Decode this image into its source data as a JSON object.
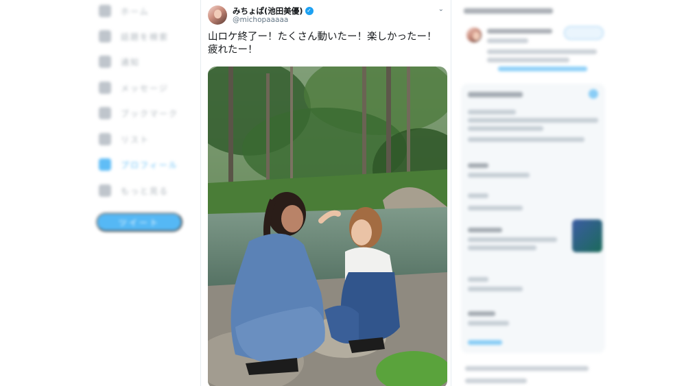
{
  "left_nav": {
    "items": [
      {
        "icon": "home-icon",
        "label": "ホーム",
        "active": false
      },
      {
        "icon": "explore-icon",
        "label": "話題を検索",
        "active": false
      },
      {
        "icon": "notifications-icon",
        "label": "通知",
        "active": false
      },
      {
        "icon": "messages-icon",
        "label": "メッセージ",
        "active": false
      },
      {
        "icon": "bookmarks-icon",
        "label": "ブックマーク",
        "active": false
      },
      {
        "icon": "lists-icon",
        "label": "リスト",
        "active": false
      },
      {
        "icon": "profile-icon",
        "label": "プロフィール",
        "active": true
      },
      {
        "icon": "more-icon",
        "label": "もっと見る",
        "active": false
      }
    ],
    "tweet_button": "ツイート"
  },
  "tweet": {
    "display_name": "みちょぱ(池田美優)",
    "handle": "@michopaaaaa",
    "verified": true,
    "text": "山ロケ終了ー！たくさん動いたー！楽しかったー！疲れたー！",
    "accent_color": "#1da1f2"
  }
}
